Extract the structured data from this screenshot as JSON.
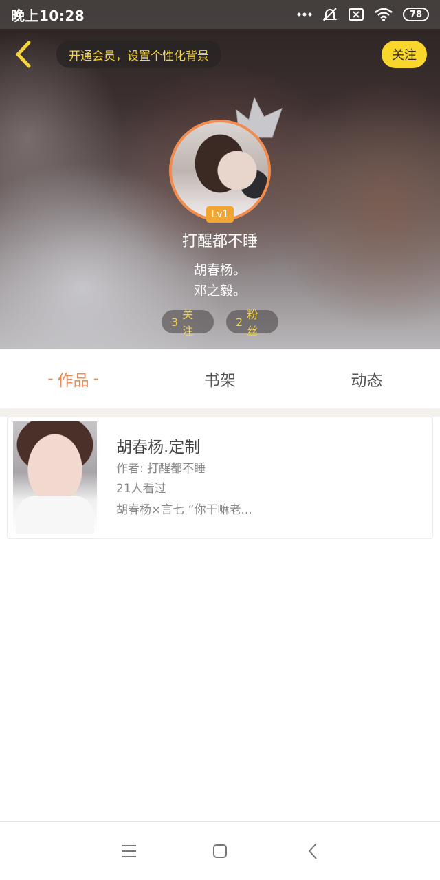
{
  "status_bar": {
    "time": "晚上10:28",
    "battery": "78"
  },
  "header": {
    "promo_text": "开通会员，设置个性化背景",
    "follow_label": "关注"
  },
  "profile": {
    "level": "Lv1",
    "nickname": "打醒都不睡",
    "bio_line1": "胡春杨。",
    "bio_line2": "邓之毅。",
    "following_count": "3",
    "following_label": "关注",
    "fans_count": "2",
    "fans_label": "粉丝"
  },
  "tabs": [
    {
      "label": "作品",
      "active": true
    },
    {
      "label": "书架",
      "active": false
    },
    {
      "label": "动态",
      "active": false
    }
  ],
  "works": [
    {
      "title": "胡春杨.定制",
      "author": "作者: 打醒都不睡",
      "views": "21人看过",
      "desc": "胡春杨×言七 “你干嘛老..."
    }
  ],
  "colors": {
    "accent": "#f08b54",
    "gold": "#f3d23c",
    "follow_bg": "#f8d62c"
  },
  "icons": {
    "back": "back-chevron-icon",
    "crown": "crown-icon",
    "nav_menu": "menu-icon",
    "nav_home": "home-square-icon",
    "nav_back": "back-arrow-icon"
  }
}
